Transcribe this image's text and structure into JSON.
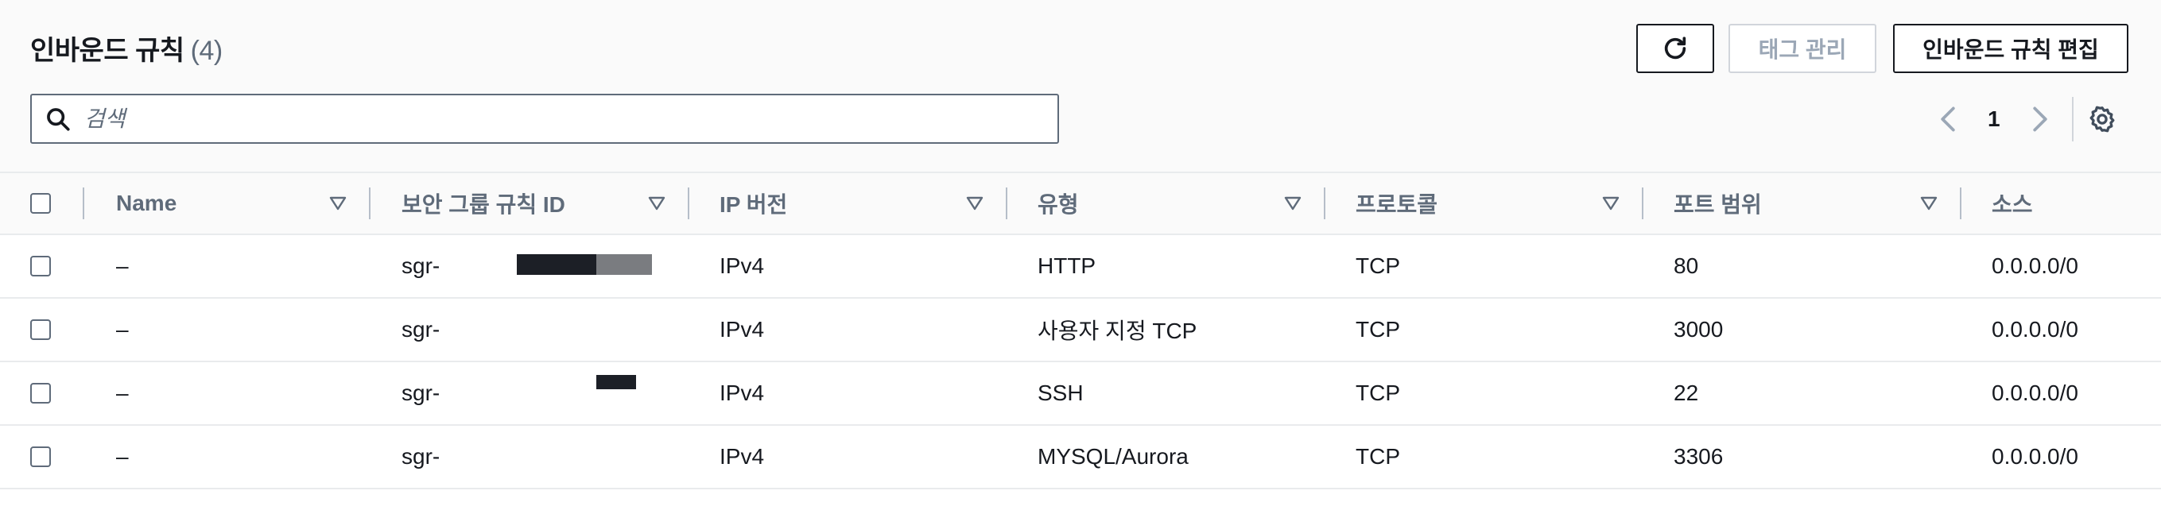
{
  "header": {
    "title": "인바운드 규칙",
    "count": "(4)",
    "tags_button": "태그 관리",
    "edit_button": "인바운드 규칙 편집"
  },
  "search": {
    "placeholder": "검색"
  },
  "pagination": {
    "page": "1"
  },
  "columns": [
    "Name",
    "보안 그룹 규칙 ID",
    "IP 버전",
    "유형",
    "프로토콜",
    "포트 범위",
    "소스"
  ],
  "rows": [
    {
      "name": "–",
      "rule_id": "sgr-",
      "ip_version": "IPv4",
      "type": "HTTP",
      "protocol": "TCP",
      "port_range": "80",
      "source": "0.0.0.0/0"
    },
    {
      "name": "–",
      "rule_id": "sgr-",
      "ip_version": "IPv4",
      "type": "사용자 지정 TCP",
      "protocol": "TCP",
      "port_range": "3000",
      "source": "0.0.0.0/0"
    },
    {
      "name": "–",
      "rule_id": "sgr-",
      "ip_version": "IPv4",
      "type": "SSH",
      "protocol": "TCP",
      "port_range": "22",
      "source": "0.0.0.0/0"
    },
    {
      "name": "–",
      "rule_id": "sgr-",
      "ip_version": "IPv4",
      "type": "MYSQL/Aurora",
      "protocol": "TCP",
      "port_range": "3306",
      "source": "0.0.0.0/0"
    }
  ],
  "icons": {
    "refresh": "refresh-icon",
    "search": "search-icon",
    "prev": "chevron-left-icon",
    "next": "chevron-right-icon",
    "settings": "gear-icon",
    "sort": "sort-triangle-icon"
  },
  "colors": {
    "text": "#16191f",
    "muted": "#5f6b7a",
    "disabled": "#9ba7b6",
    "border": "#e9ebed",
    "header_bg": "#fafafa"
  }
}
